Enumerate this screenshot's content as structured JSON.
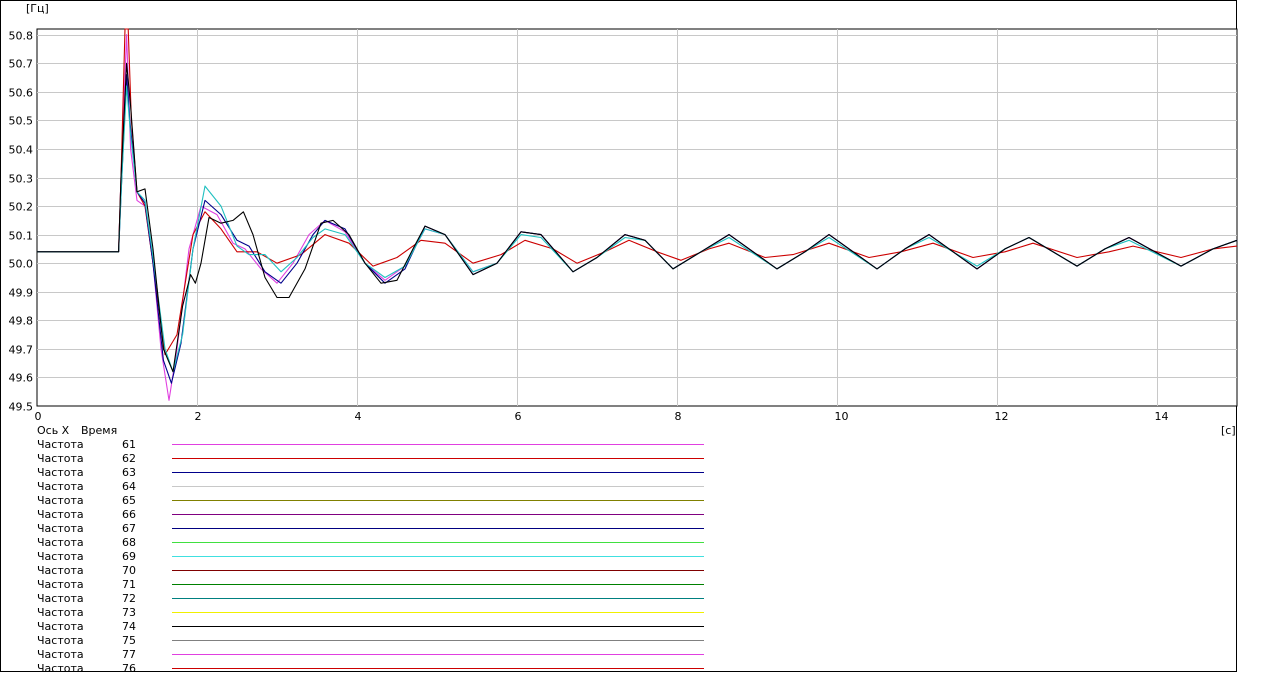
{
  "chart_data": {
    "type": "line",
    "ylabel": "[Гц]",
    "xlabel": "[с]",
    "x_axis_caption": "Ось X",
    "x_axis_name": "Время",
    "xlim": [
      0,
      15
    ],
    "ylim": [
      49.5,
      50.82
    ],
    "x_ticks": [
      0,
      2,
      4,
      6,
      8,
      10,
      12,
      14
    ],
    "y_ticks": [
      49.5,
      49.6,
      49.7,
      49.8,
      49.9,
      50.0,
      50.1,
      50.2,
      50.3,
      50.4,
      50.5,
      50.6,
      50.7,
      50.8
    ],
    "grid": true,
    "legend_position": "bottom-left",
    "series": [
      {
        "name": "Частота",
        "number": "61",
        "color": "#e040e0",
        "points": [
          [
            0,
            50.04
          ],
          [
            1.02,
            50.04
          ],
          [
            1.05,
            50.3
          ],
          [
            1.12,
            50.8
          ],
          [
            1.17,
            50.4
          ],
          [
            1.25,
            50.22
          ],
          [
            1.35,
            50.2
          ],
          [
            1.45,
            50.0
          ],
          [
            1.55,
            49.7
          ],
          [
            1.65,
            49.52
          ],
          [
            1.75,
            49.7
          ],
          [
            1.9,
            50.05
          ],
          [
            2.05,
            50.2
          ],
          [
            2.25,
            50.17
          ],
          [
            2.45,
            50.07
          ],
          [
            2.6,
            50.05
          ],
          [
            2.8,
            49.98
          ],
          [
            3.0,
            49.93
          ],
          [
            3.2,
            50.0
          ],
          [
            3.4,
            50.1
          ],
          [
            3.6,
            50.15
          ],
          [
            3.85,
            50.11
          ],
          [
            4.1,
            50.0
          ],
          [
            4.35,
            49.94
          ],
          [
            4.6,
            49.99
          ],
          [
            4.85,
            50.12
          ],
          [
            5.1,
            50.1
          ],
          [
            5.45,
            49.97
          ],
          [
            5.75,
            50.0
          ],
          [
            6.05,
            50.11
          ],
          [
            6.3,
            50.1
          ],
          [
            6.7,
            49.97
          ],
          [
            7.0,
            50.02
          ],
          [
            7.35,
            50.1
          ],
          [
            7.6,
            50.08
          ],
          [
            7.95,
            49.98
          ],
          [
            8.3,
            50.04
          ],
          [
            8.65,
            50.1
          ],
          [
            9.25,
            49.98
          ],
          [
            9.6,
            50.04
          ],
          [
            9.9,
            50.1
          ],
          [
            10.5,
            49.98
          ],
          [
            10.85,
            50.05
          ],
          [
            11.15,
            50.1
          ],
          [
            11.75,
            49.98
          ],
          [
            12.1,
            50.05
          ],
          [
            12.4,
            50.09
          ],
          [
            13.0,
            49.99
          ],
          [
            13.35,
            50.05
          ],
          [
            13.65,
            50.09
          ],
          [
            14.3,
            49.99
          ],
          [
            14.7,
            50.05
          ],
          [
            15,
            50.08
          ]
        ]
      },
      {
        "name": "Частота",
        "number": "62",
        "color": "#cc0000",
        "points": [
          [
            0,
            50.04
          ],
          [
            1.02,
            50.04
          ],
          [
            1.05,
            50.3
          ],
          [
            1.1,
            50.82
          ],
          [
            1.14,
            50.82
          ],
          [
            1.18,
            50.5
          ],
          [
            1.25,
            50.25
          ],
          [
            1.35,
            50.2
          ],
          [
            1.45,
            50.0
          ],
          [
            1.6,
            49.68
          ],
          [
            1.75,
            49.75
          ],
          [
            1.95,
            50.1
          ],
          [
            2.1,
            50.18
          ],
          [
            2.3,
            50.12
          ],
          [
            2.5,
            50.04
          ],
          [
            2.75,
            50.04
          ],
          [
            3.0,
            50.0
          ],
          [
            3.3,
            50.03
          ],
          [
            3.6,
            50.1
          ],
          [
            3.9,
            50.07
          ],
          [
            4.2,
            49.99
          ],
          [
            4.5,
            50.02
          ],
          [
            4.8,
            50.08
          ],
          [
            5.1,
            50.07
          ],
          [
            5.45,
            50.0
          ],
          [
            5.8,
            50.03
          ],
          [
            6.1,
            50.08
          ],
          [
            6.45,
            50.05
          ],
          [
            6.75,
            50.0
          ],
          [
            7.1,
            50.04
          ],
          [
            7.4,
            50.08
          ],
          [
            7.75,
            50.04
          ],
          [
            8.05,
            50.01
          ],
          [
            8.4,
            50.05
          ],
          [
            8.65,
            50.07
          ],
          [
            9.1,
            50.02
          ],
          [
            9.45,
            50.03
          ],
          [
            9.9,
            50.07
          ],
          [
            10.4,
            50.02
          ],
          [
            10.8,
            50.04
          ],
          [
            11.2,
            50.07
          ],
          [
            11.7,
            50.02
          ],
          [
            12.1,
            50.04
          ],
          [
            12.45,
            50.07
          ],
          [
            13.0,
            50.02
          ],
          [
            13.4,
            50.04
          ],
          [
            13.7,
            50.06
          ],
          [
            14.3,
            50.02
          ],
          [
            14.7,
            50.05
          ],
          [
            15,
            50.06
          ]
        ]
      },
      {
        "name": "Частота",
        "number": "63",
        "color": "#00008b",
        "points": [
          [
            0,
            50.04
          ],
          [
            1.02,
            50.04
          ],
          [
            1.06,
            50.3
          ],
          [
            1.12,
            50.66
          ],
          [
            1.16,
            50.5
          ],
          [
            1.25,
            50.25
          ],
          [
            1.35,
            50.21
          ],
          [
            1.45,
            50.0
          ],
          [
            1.58,
            49.66
          ],
          [
            1.68,
            49.58
          ],
          [
            1.8,
            49.72
          ],
          [
            1.95,
            50.05
          ],
          [
            2.1,
            50.22
          ],
          [
            2.3,
            50.17
          ],
          [
            2.5,
            50.08
          ],
          [
            2.65,
            50.06
          ],
          [
            2.85,
            49.97
          ],
          [
            3.05,
            49.93
          ],
          [
            3.25,
            50.0
          ],
          [
            3.45,
            50.1
          ],
          [
            3.6,
            50.15
          ],
          [
            3.85,
            50.12
          ],
          [
            4.1,
            50.0
          ],
          [
            4.35,
            49.93
          ],
          [
            4.6,
            49.98
          ],
          [
            4.85,
            50.13
          ],
          [
            5.1,
            50.1
          ],
          [
            5.45,
            49.96
          ],
          [
            5.75,
            50.0
          ],
          [
            6.05,
            50.11
          ],
          [
            6.3,
            50.1
          ],
          [
            6.7,
            49.97
          ],
          [
            7.0,
            50.02
          ],
          [
            7.35,
            50.1
          ],
          [
            7.6,
            50.08
          ],
          [
            7.95,
            49.98
          ],
          [
            8.3,
            50.04
          ],
          [
            8.65,
            50.1
          ],
          [
            9.25,
            49.98
          ],
          [
            9.6,
            50.04
          ],
          [
            9.9,
            50.1
          ],
          [
            10.5,
            49.98
          ],
          [
            10.85,
            50.05
          ],
          [
            11.15,
            50.1
          ],
          [
            11.75,
            49.98
          ],
          [
            12.1,
            50.05
          ],
          [
            12.4,
            50.09
          ],
          [
            13.0,
            49.99
          ],
          [
            13.35,
            50.05
          ],
          [
            13.65,
            50.09
          ],
          [
            14.3,
            49.99
          ],
          [
            14.7,
            50.05
          ],
          [
            15,
            50.08
          ]
        ]
      },
      {
        "name": "Частота",
        "number": "69",
        "color": "#20c0c0",
        "points": [
          [
            0,
            50.04
          ],
          [
            1.02,
            50.04
          ],
          [
            1.06,
            50.3
          ],
          [
            1.12,
            50.62
          ],
          [
            1.17,
            50.45
          ],
          [
            1.25,
            50.25
          ],
          [
            1.35,
            50.22
          ],
          [
            1.45,
            50.02
          ],
          [
            1.6,
            49.7
          ],
          [
            1.7,
            49.62
          ],
          [
            1.82,
            49.75
          ],
          [
            1.95,
            50.05
          ],
          [
            2.1,
            50.27
          ],
          [
            2.3,
            50.2
          ],
          [
            2.5,
            50.06
          ],
          [
            2.65,
            50.03
          ],
          [
            2.85,
            50.03
          ],
          [
            3.05,
            49.97
          ],
          [
            3.25,
            50.02
          ],
          [
            3.45,
            50.09
          ],
          [
            3.6,
            50.12
          ],
          [
            3.85,
            50.1
          ],
          [
            4.1,
            50.0
          ],
          [
            4.35,
            49.95
          ],
          [
            4.6,
            49.99
          ],
          [
            4.85,
            50.12
          ],
          [
            5.1,
            50.1
          ],
          [
            5.45,
            49.97
          ],
          [
            5.75,
            50.0
          ],
          [
            6.05,
            50.1
          ],
          [
            6.3,
            50.09
          ],
          [
            6.7,
            49.97
          ],
          [
            7.0,
            50.02
          ],
          [
            7.35,
            50.09
          ],
          [
            7.6,
            50.08
          ],
          [
            7.95,
            49.98
          ],
          [
            8.3,
            50.04
          ],
          [
            8.65,
            50.09
          ],
          [
            9.25,
            49.98
          ],
          [
            9.6,
            50.04
          ],
          [
            9.9,
            50.09
          ],
          [
            10.5,
            49.98
          ],
          [
            10.85,
            50.05
          ],
          [
            11.15,
            50.09
          ],
          [
            11.75,
            49.99
          ],
          [
            12.1,
            50.05
          ],
          [
            12.4,
            50.09
          ],
          [
            13.0,
            49.99
          ],
          [
            13.35,
            50.05
          ],
          [
            13.65,
            50.08
          ],
          [
            14.3,
            49.99
          ],
          [
            14.7,
            50.05
          ],
          [
            15,
            50.08
          ]
        ]
      },
      {
        "name": "Частота",
        "number": "74",
        "color": "#000000",
        "points": [
          [
            0,
            50.04
          ],
          [
            1.02,
            50.04
          ],
          [
            1.05,
            50.3
          ],
          [
            1.12,
            50.7
          ],
          [
            1.17,
            50.55
          ],
          [
            1.25,
            50.25
          ],
          [
            1.35,
            50.26
          ],
          [
            1.45,
            50.05
          ],
          [
            1.58,
            49.7
          ],
          [
            1.7,
            49.62
          ],
          [
            1.82,
            49.85
          ],
          [
            1.92,
            49.96
          ],
          [
            1.98,
            49.93
          ],
          [
            2.05,
            50.0
          ],
          [
            2.15,
            50.16
          ],
          [
            2.3,
            50.14
          ],
          [
            2.45,
            50.15
          ],
          [
            2.58,
            50.18
          ],
          [
            2.7,
            50.1
          ],
          [
            2.85,
            49.95
          ],
          [
            3.0,
            49.88
          ],
          [
            3.15,
            49.88
          ],
          [
            3.35,
            49.98
          ],
          [
            3.55,
            50.14
          ],
          [
            3.7,
            50.15
          ],
          [
            3.9,
            50.1
          ],
          [
            4.1,
            50.0
          ],
          [
            4.3,
            49.93
          ],
          [
            4.5,
            49.94
          ],
          [
            4.7,
            50.05
          ],
          [
            4.85,
            50.13
          ],
          [
            5.1,
            50.1
          ],
          [
            5.45,
            49.96
          ],
          [
            5.75,
            50.0
          ],
          [
            6.05,
            50.11
          ],
          [
            6.3,
            50.1
          ],
          [
            6.7,
            49.97
          ],
          [
            7.0,
            50.02
          ],
          [
            7.35,
            50.1
          ],
          [
            7.6,
            50.08
          ],
          [
            7.95,
            49.98
          ],
          [
            8.3,
            50.04
          ],
          [
            8.65,
            50.1
          ],
          [
            9.25,
            49.98
          ],
          [
            9.6,
            50.04
          ],
          [
            9.9,
            50.1
          ],
          [
            10.5,
            49.98
          ],
          [
            10.85,
            50.05
          ],
          [
            11.15,
            50.1
          ],
          [
            11.75,
            49.98
          ],
          [
            12.1,
            50.05
          ],
          [
            12.4,
            50.09
          ],
          [
            13.0,
            49.99
          ],
          [
            13.35,
            50.05
          ],
          [
            13.65,
            50.09
          ],
          [
            14.3,
            49.99
          ],
          [
            14.7,
            50.05
          ],
          [
            15,
            50.08
          ]
        ]
      }
    ]
  },
  "legend": {
    "header_axis": "Ось X",
    "header_name": "Время",
    "items": [
      {
        "name": "Частота",
        "number": "61",
        "color": "#e040e0"
      },
      {
        "name": "Частота",
        "number": "62",
        "color": "#cc0000"
      },
      {
        "name": "Частота",
        "number": "63",
        "color": "#00008b"
      },
      {
        "name": "Частота",
        "number": "64",
        "color": "#c8c8c8"
      },
      {
        "name": "Частота",
        "number": "65",
        "color": "#808000"
      },
      {
        "name": "Частота",
        "number": "66",
        "color": "#800080"
      },
      {
        "name": "Частота",
        "number": "67",
        "color": "#000080"
      },
      {
        "name": "Частота",
        "number": "68",
        "color": "#40e040"
      },
      {
        "name": "Частота",
        "number": "69",
        "color": "#40e0e0"
      },
      {
        "name": "Частота",
        "number": "70",
        "color": "#800000"
      },
      {
        "name": "Частота",
        "number": "71",
        "color": "#008000"
      },
      {
        "name": "Частота",
        "number": "72",
        "color": "#008080"
      },
      {
        "name": "Частота",
        "number": "73",
        "color": "#f0f000"
      },
      {
        "name": "Частота",
        "number": "74",
        "color": "#000000"
      },
      {
        "name": "Частота",
        "number": "75",
        "color": "#808080"
      },
      {
        "name": "Частота",
        "number": "77",
        "color": "#e040e0"
      },
      {
        "name": "Частота",
        "number": "76",
        "color": "#cc0000"
      }
    ]
  }
}
